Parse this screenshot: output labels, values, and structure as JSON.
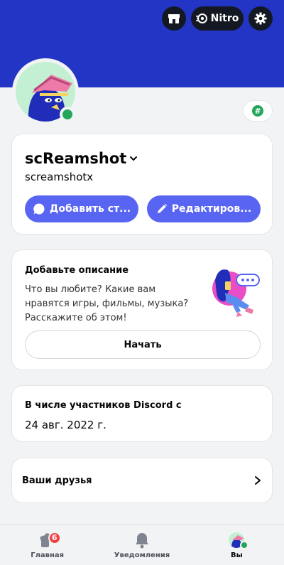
{
  "header": {
    "nitro_label": "Nitro",
    "banner_color": "#2335c4",
    "shop_icon": "shop-icon",
    "nitro_icon": "nitro-icon",
    "settings_icon": "gear-icon"
  },
  "profile": {
    "display_name": "scReamshot",
    "username": "screamshotx",
    "status": "online",
    "status_color": "#23a55a",
    "add_status_label": "Добавить ст...",
    "edit_label": "Редактиров...",
    "accent_color": "#5865f2"
  },
  "description": {
    "title": "Добавьте описание",
    "body": "Что вы любите? Какие вам нравятся игры, фильмы, музыка? Расскажите об этом!",
    "start_label": "Начать"
  },
  "member_since": {
    "title": "В числе участников Discord с",
    "date": "24 авг. 2022 г."
  },
  "friends": {
    "label": "Ваши друзья"
  },
  "nav": {
    "home_label": "Главная",
    "home_badge": "6",
    "notifications_label": "Уведомления",
    "you_label": "Вы"
  }
}
